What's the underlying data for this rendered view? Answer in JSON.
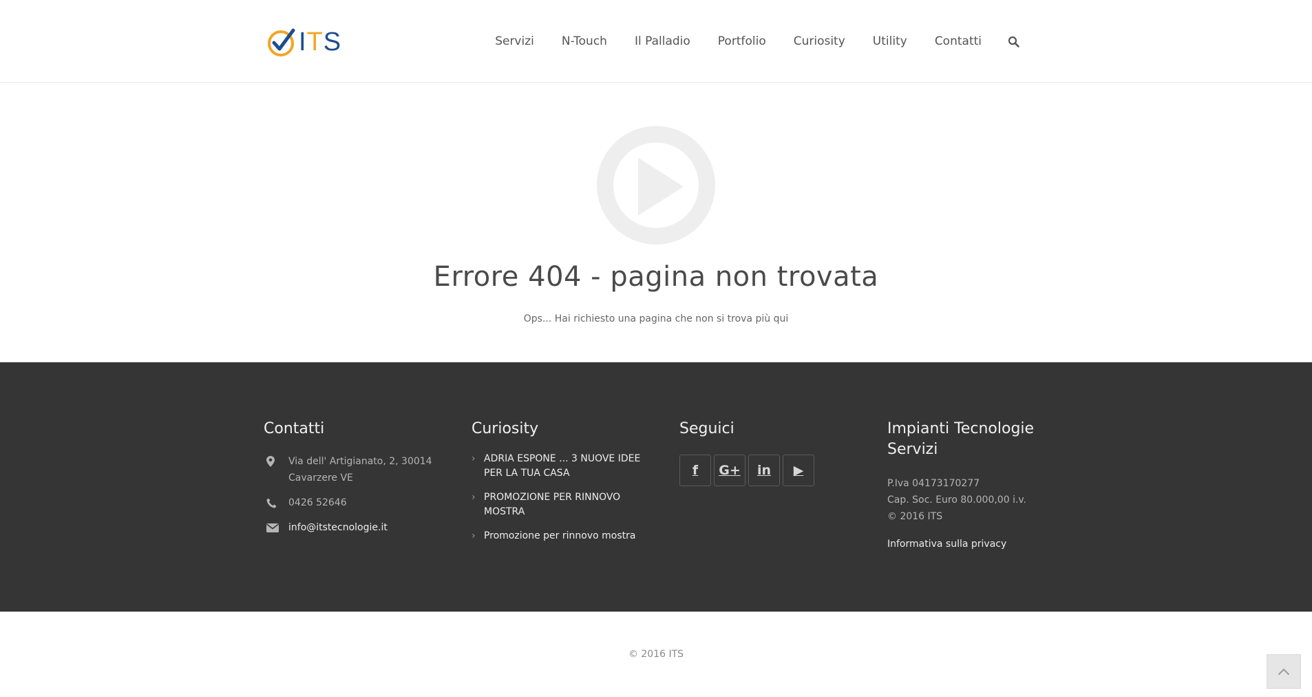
{
  "header": {
    "logo": {
      "text_main": "ITS",
      "text_accent": "T",
      "text_prefix": "I",
      "text_suffix": "S"
    },
    "nav": [
      "Servizi",
      "N-Touch",
      "Il Palladio",
      "Portfolio",
      "Curiosity",
      "Utility",
      "Contatti"
    ],
    "search_icon": "search-icon"
  },
  "main": {
    "icon": "play-circle-icon",
    "title": "Errore 404 - pagina non trovata",
    "subtitle": "Ops... Hai richiesto una pagina che non si trova più qui"
  },
  "footer": {
    "contacts": {
      "title": "Contatti",
      "address_line1": "Via dell' Artigianato, 2, 30014",
      "address_line2": "Cavarzere VE",
      "phone": "0426 52646",
      "email": "info@itstecnologie.it"
    },
    "curiosity": {
      "title": "Curiosity",
      "items": [
        [
          "ADRIA ESPONE ... 3 NUOVE IDEE",
          "PER LA TUA CASA"
        ],
        [
          "PROMOZIONE PER RINNOVO",
          "MOSTRA"
        ],
        [
          "Promozione per rinnovo mostra",
          ""
        ]
      ]
    },
    "follow": {
      "title": "Seguici",
      "icons": [
        "facebook-icon",
        "google-plus-icon",
        "linkedin-icon",
        "youtube-icon"
      ],
      "labels": [
        "f",
        "G+",
        "in",
        "▶"
      ]
    },
    "company": {
      "title_line1": "Impianti Tecnologie",
      "title_line2": "Servizi",
      "vat": "P.Iva 04173170277",
      "capital": "Cap. Soc. Euro 80.000,00 i.v.",
      "copyright": "© 2016 ITS",
      "privacy": "Informativa sulla privacy"
    }
  },
  "bottom": {
    "copyright": "© 2016 ITS"
  },
  "colors": {
    "footer_bg": "#353535",
    "logo_blue": "#1b4d8f",
    "logo_yellow": "#f1a625"
  }
}
